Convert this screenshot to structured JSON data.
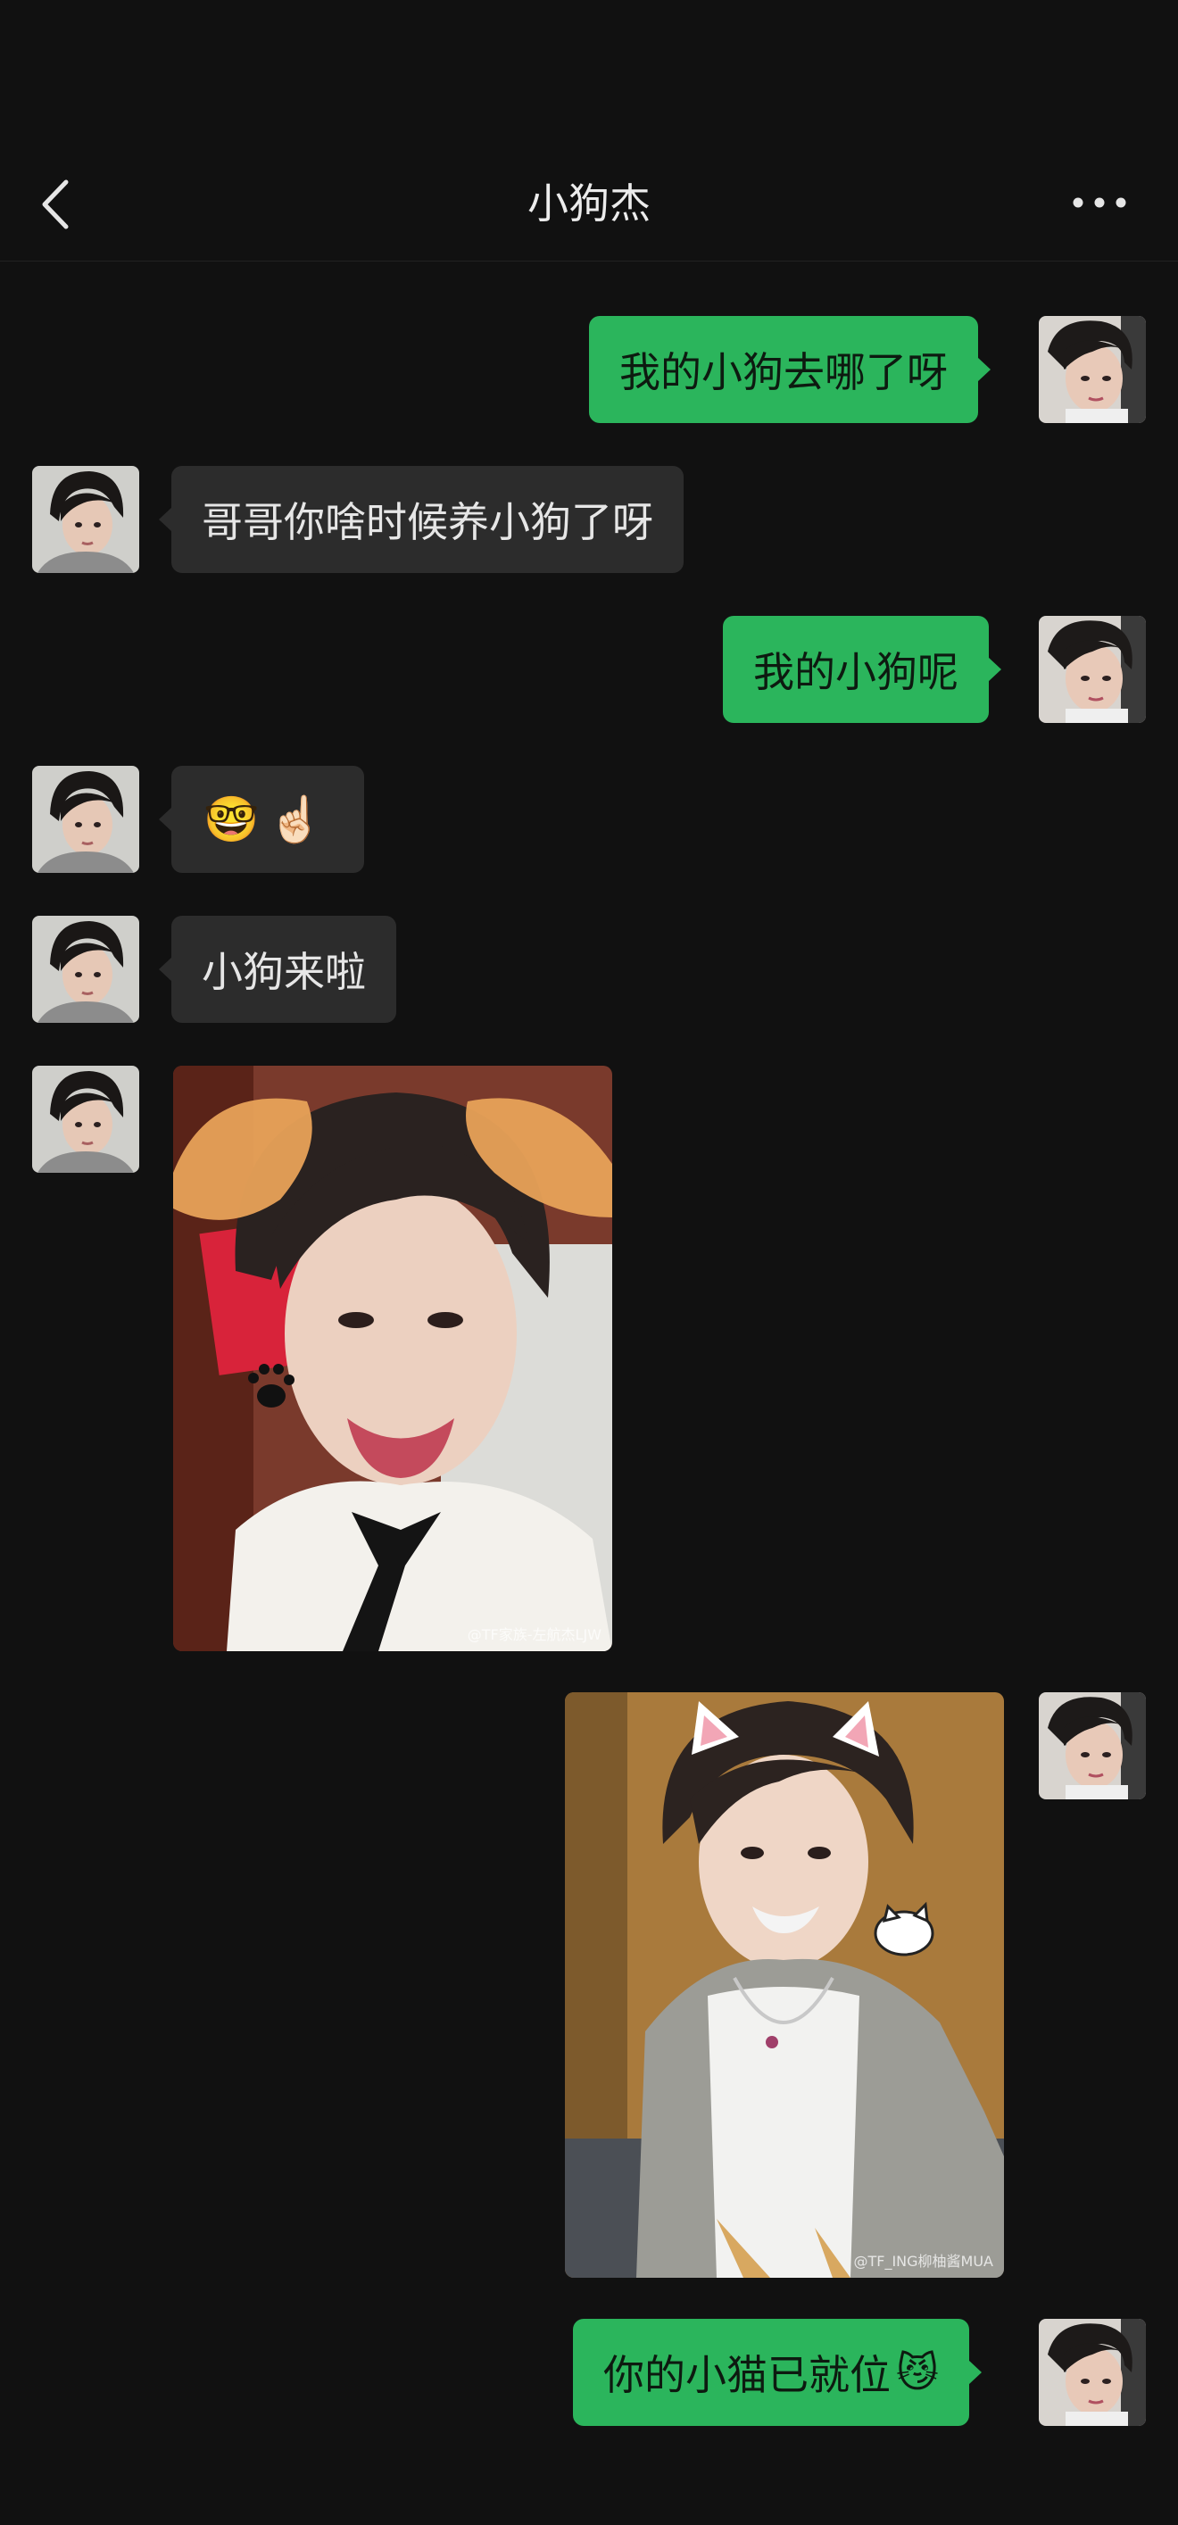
{
  "header": {
    "title": "小狗杰",
    "back_icon": "chevron-left-icon",
    "more_icon": "more-dots-icon"
  },
  "colors": {
    "background": "#111111",
    "outgoing_bubble": "#2bb55c",
    "incoming_bubble": "#2c2c2c"
  },
  "messages": [
    {
      "side": "out",
      "type": "text",
      "text": "我的小狗去哪了呀"
    },
    {
      "side": "in",
      "type": "text",
      "text": "哥哥你啥时候养小狗了呀"
    },
    {
      "side": "out",
      "type": "text",
      "text": "我的小狗呢"
    },
    {
      "side": "in",
      "type": "emoji",
      "emoji": [
        "🤓",
        "☝🏻"
      ]
    },
    {
      "side": "in",
      "type": "text",
      "text": "小狗来啦"
    },
    {
      "side": "in",
      "type": "image",
      "image": "dog-ears-selfie",
      "watermark": "@TF家族-左航杰LJW"
    },
    {
      "side": "out",
      "type": "image",
      "image": "cat-ears-selfie",
      "watermark": "@TF_ING柳柚酱MUA"
    },
    {
      "side": "out",
      "type": "text",
      "text": "你的小猫已就位",
      "emoji": "😼"
    }
  ]
}
